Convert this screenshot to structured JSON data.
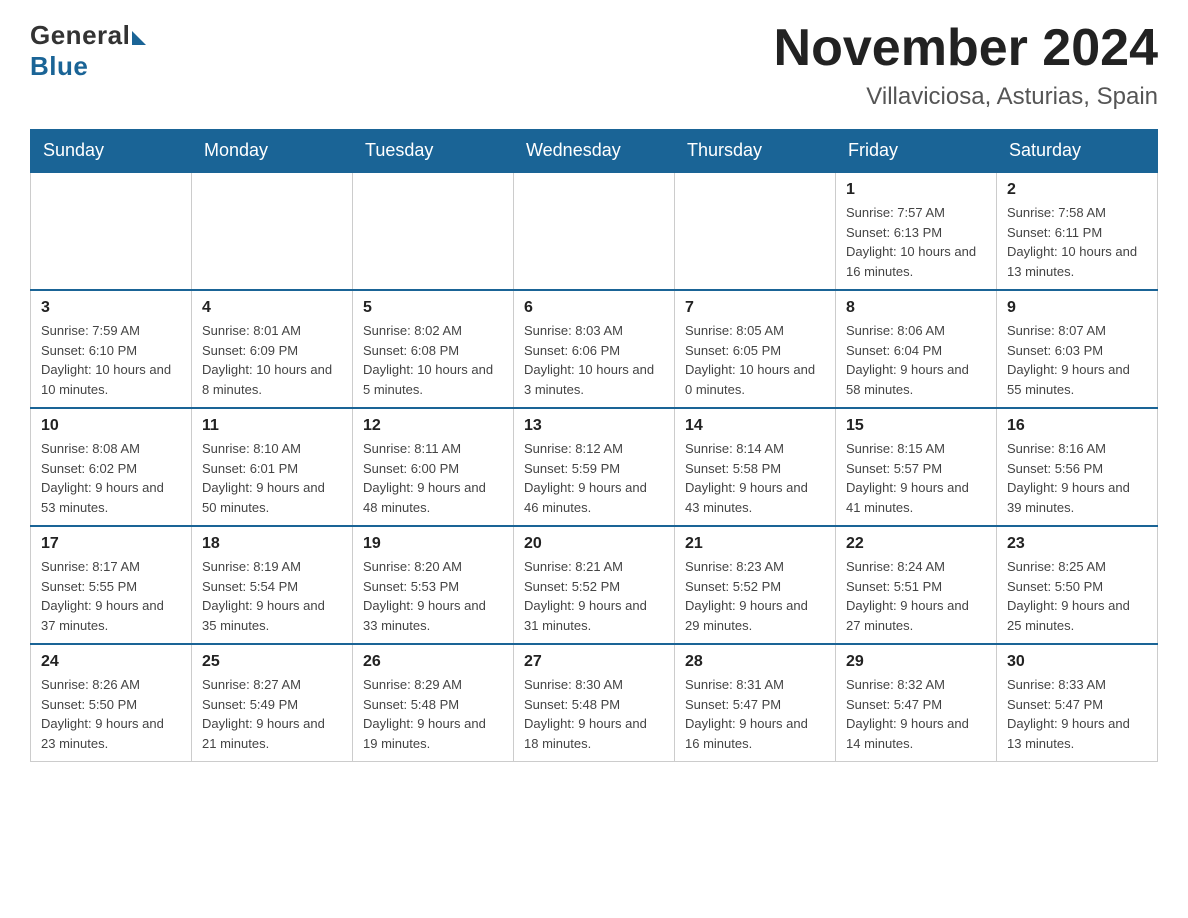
{
  "header": {
    "logo_general": "General",
    "logo_blue": "Blue",
    "main_title": "November 2024",
    "subtitle": "Villaviciosa, Asturias, Spain"
  },
  "calendar": {
    "days_of_week": [
      "Sunday",
      "Monday",
      "Tuesday",
      "Wednesday",
      "Thursday",
      "Friday",
      "Saturday"
    ],
    "weeks": [
      [
        {
          "day": "",
          "info": ""
        },
        {
          "day": "",
          "info": ""
        },
        {
          "day": "",
          "info": ""
        },
        {
          "day": "",
          "info": ""
        },
        {
          "day": "",
          "info": ""
        },
        {
          "day": "1",
          "info": "Sunrise: 7:57 AM\nSunset: 6:13 PM\nDaylight: 10 hours and 16 minutes."
        },
        {
          "day": "2",
          "info": "Sunrise: 7:58 AM\nSunset: 6:11 PM\nDaylight: 10 hours and 13 minutes."
        }
      ],
      [
        {
          "day": "3",
          "info": "Sunrise: 7:59 AM\nSunset: 6:10 PM\nDaylight: 10 hours and 10 minutes."
        },
        {
          "day": "4",
          "info": "Sunrise: 8:01 AM\nSunset: 6:09 PM\nDaylight: 10 hours and 8 minutes."
        },
        {
          "day": "5",
          "info": "Sunrise: 8:02 AM\nSunset: 6:08 PM\nDaylight: 10 hours and 5 minutes."
        },
        {
          "day": "6",
          "info": "Sunrise: 8:03 AM\nSunset: 6:06 PM\nDaylight: 10 hours and 3 minutes."
        },
        {
          "day": "7",
          "info": "Sunrise: 8:05 AM\nSunset: 6:05 PM\nDaylight: 10 hours and 0 minutes."
        },
        {
          "day": "8",
          "info": "Sunrise: 8:06 AM\nSunset: 6:04 PM\nDaylight: 9 hours and 58 minutes."
        },
        {
          "day": "9",
          "info": "Sunrise: 8:07 AM\nSunset: 6:03 PM\nDaylight: 9 hours and 55 minutes."
        }
      ],
      [
        {
          "day": "10",
          "info": "Sunrise: 8:08 AM\nSunset: 6:02 PM\nDaylight: 9 hours and 53 minutes."
        },
        {
          "day": "11",
          "info": "Sunrise: 8:10 AM\nSunset: 6:01 PM\nDaylight: 9 hours and 50 minutes."
        },
        {
          "day": "12",
          "info": "Sunrise: 8:11 AM\nSunset: 6:00 PM\nDaylight: 9 hours and 48 minutes."
        },
        {
          "day": "13",
          "info": "Sunrise: 8:12 AM\nSunset: 5:59 PM\nDaylight: 9 hours and 46 minutes."
        },
        {
          "day": "14",
          "info": "Sunrise: 8:14 AM\nSunset: 5:58 PM\nDaylight: 9 hours and 43 minutes."
        },
        {
          "day": "15",
          "info": "Sunrise: 8:15 AM\nSunset: 5:57 PM\nDaylight: 9 hours and 41 minutes."
        },
        {
          "day": "16",
          "info": "Sunrise: 8:16 AM\nSunset: 5:56 PM\nDaylight: 9 hours and 39 minutes."
        }
      ],
      [
        {
          "day": "17",
          "info": "Sunrise: 8:17 AM\nSunset: 5:55 PM\nDaylight: 9 hours and 37 minutes."
        },
        {
          "day": "18",
          "info": "Sunrise: 8:19 AM\nSunset: 5:54 PM\nDaylight: 9 hours and 35 minutes."
        },
        {
          "day": "19",
          "info": "Sunrise: 8:20 AM\nSunset: 5:53 PM\nDaylight: 9 hours and 33 minutes."
        },
        {
          "day": "20",
          "info": "Sunrise: 8:21 AM\nSunset: 5:52 PM\nDaylight: 9 hours and 31 minutes."
        },
        {
          "day": "21",
          "info": "Sunrise: 8:23 AM\nSunset: 5:52 PM\nDaylight: 9 hours and 29 minutes."
        },
        {
          "day": "22",
          "info": "Sunrise: 8:24 AM\nSunset: 5:51 PM\nDaylight: 9 hours and 27 minutes."
        },
        {
          "day": "23",
          "info": "Sunrise: 8:25 AM\nSunset: 5:50 PM\nDaylight: 9 hours and 25 minutes."
        }
      ],
      [
        {
          "day": "24",
          "info": "Sunrise: 8:26 AM\nSunset: 5:50 PM\nDaylight: 9 hours and 23 minutes."
        },
        {
          "day": "25",
          "info": "Sunrise: 8:27 AM\nSunset: 5:49 PM\nDaylight: 9 hours and 21 minutes."
        },
        {
          "day": "26",
          "info": "Sunrise: 8:29 AM\nSunset: 5:48 PM\nDaylight: 9 hours and 19 minutes."
        },
        {
          "day": "27",
          "info": "Sunrise: 8:30 AM\nSunset: 5:48 PM\nDaylight: 9 hours and 18 minutes."
        },
        {
          "day": "28",
          "info": "Sunrise: 8:31 AM\nSunset: 5:47 PM\nDaylight: 9 hours and 16 minutes."
        },
        {
          "day": "29",
          "info": "Sunrise: 8:32 AM\nSunset: 5:47 PM\nDaylight: 9 hours and 14 minutes."
        },
        {
          "day": "30",
          "info": "Sunrise: 8:33 AM\nSunset: 5:47 PM\nDaylight: 9 hours and 13 minutes."
        }
      ]
    ]
  }
}
